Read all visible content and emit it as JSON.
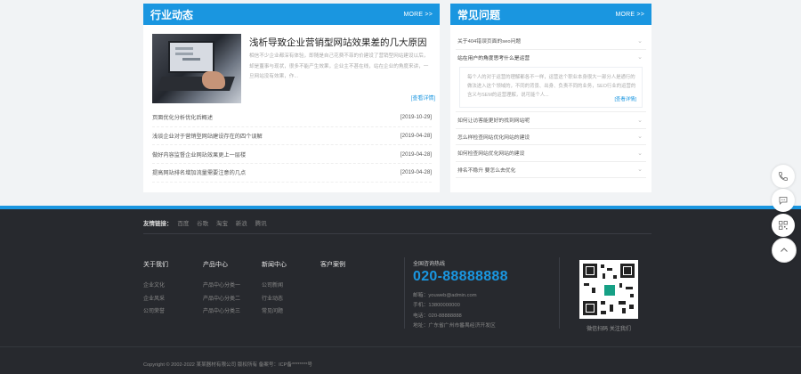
{
  "news": {
    "title": "行业动态",
    "more": "MORE >>",
    "feature": {
      "title": "浅析导致企业营销型网站效果差的几大原因",
      "desc": "相信不少企业都深有体验，即随是自己花费不菲的价建设了营销型网站建设以后，却是董事与现状，很多不能产生效果，企业主不甚在线，站在企业的角度来讲，一旦网站没有效果，作...",
      "detail": "[查看详情]"
    },
    "items": [
      {
        "title": "页面优化分析优化后概述",
        "date": "[2019-10-29]"
      },
      {
        "title": "浅谈企业对于营销型网站建设存在的四个误解",
        "date": "[2019-04-28]"
      },
      {
        "title": "做好内容监督企业网站效果更上一层楼",
        "date": "[2019-04-28]"
      },
      {
        "title": "提高网站排名增加流量需要注意的几点",
        "date": "[2019-04-28]"
      }
    ]
  },
  "faq": {
    "title": "常见问题",
    "more": "MORE >>",
    "items": [
      {
        "title": "关于404错误页面的seo问题"
      },
      {
        "title": "站在用户的角度思考什么是运营",
        "answer": "每个人的对于运营的理解都各不一样，运营这个职业本身很大一部分人是通行的做法进入这个领域的，不同的背景、出身、负责不同的业务，SEO行业的运营的含义与SEM的运营理解，说可能个人..."
      },
      {
        "title": "如何让访客能更好的找到网站呢"
      },
      {
        "title": "怎么样检查网站优化网站的建设"
      },
      {
        "title": "如何检查网站优化网站的建设"
      },
      {
        "title": "排名不稳升 要怎么去优化"
      }
    ],
    "detail": "[查看详情]"
  },
  "footer": {
    "links_label": "友情链接：",
    "links": [
      "百度",
      "谷歌",
      "淘宝",
      "新浪",
      "腾讯"
    ],
    "columns": [
      {
        "title": "关于我们",
        "items": [
          "企业文化",
          "企业风采",
          "公司荣誉"
        ]
      },
      {
        "title": "产品中心",
        "items": [
          "产品中心分类一",
          "产品中心分类二",
          "产品中心分类三"
        ]
      },
      {
        "title": "新闻中心",
        "items": [
          "公司新闻",
          "行业动态",
          "常见问题"
        ]
      },
      {
        "title": "客户案例",
        "items": []
      }
    ],
    "contact": {
      "label": "全国咨询热线",
      "phone": "020-88888888",
      "lines": [
        "邮箱：youweb@admin.com",
        "手机：13800000000",
        "电话：020-88888888",
        "地址：广东省广州市番禺经济开发区"
      ]
    },
    "qr_caption": "微信扫码 关注我们",
    "copyright": "Copyright © 2002-2022 某某器材有限公司 版权所有    备案号：ICP备********号"
  },
  "side_buttons": [
    "phone-icon",
    "chat-icon",
    "qrcode-icon",
    "arrow-up-icon"
  ]
}
